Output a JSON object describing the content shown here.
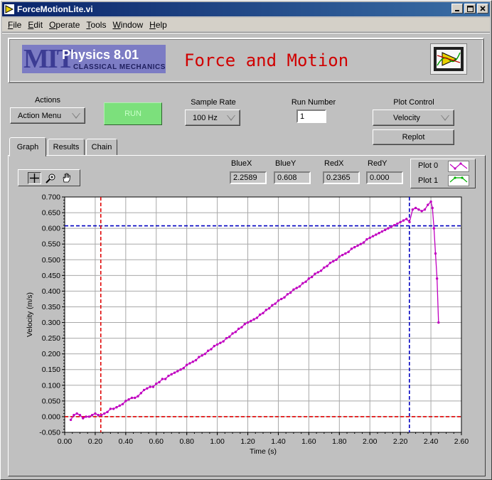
{
  "window": {
    "title": "ForceMotionLite.vi",
    "buttons": [
      "minimize",
      "maximize",
      "close"
    ]
  },
  "menu": [
    "File",
    "Edit",
    "Operate",
    "Tools",
    "Window",
    "Help"
  ],
  "banner": {
    "logo_mit": "MIT",
    "logo_course": "Physics 8.01",
    "logo_sub": "CLASSICAL MECHANICS",
    "title": "Force and Motion",
    "title_color": "#d00000"
  },
  "controls": {
    "actions_label": "Actions",
    "actions_value": "Action Menu",
    "run_label": "RUN",
    "run_color": "#7ce07c",
    "sample_rate_label": "Sample Rate",
    "sample_rate_value": "100 Hz",
    "run_number_label": "Run Number",
    "run_number_value": "1",
    "plot_control_label": "Plot Control",
    "plot_control_value": "Velocity",
    "replot_label": "Replot"
  },
  "tabs": [
    {
      "label": "Graph",
      "active": true
    },
    {
      "label": "Results",
      "active": false
    },
    {
      "label": "Chain",
      "active": false
    }
  ],
  "palette": [
    "crosshair-icon",
    "zoom-icon",
    "hand-icon"
  ],
  "cursors": {
    "blue_x_label": "BlueX",
    "blue_x": "2.2589",
    "blue_y_label": "BlueY",
    "blue_y": "0.608",
    "red_x_label": "RedX",
    "red_x": "0.2365",
    "red_y_label": "RedY",
    "red_y": "0.000"
  },
  "legend": [
    {
      "name": "Plot 0",
      "color": "#c000c0"
    },
    {
      "name": "Plot 1",
      "color": "#00b000"
    }
  ],
  "chart_data": {
    "type": "line",
    "xlabel": "Time (s)",
    "ylabel": "Velocity (m/s)",
    "xlim": [
      0.0,
      2.6
    ],
    "ylim": [
      -0.05,
      0.7
    ],
    "x_ticks": [
      "0.00",
      "0.20",
      "0.40",
      "0.60",
      "0.80",
      "1.00",
      "1.20",
      "1.40",
      "1.60",
      "1.80",
      "2.00",
      "2.20",
      "2.40",
      "2.60"
    ],
    "y_ticks": [
      "-0.050",
      "0.000",
      "0.050",
      "0.100",
      "0.150",
      "0.200",
      "0.250",
      "0.300",
      "0.350",
      "0.400",
      "0.450",
      "0.500",
      "0.550",
      "0.600",
      "0.650",
      "0.700"
    ],
    "grid": true,
    "series": [
      {
        "color": "#c000c0",
        "points": [
          [
            0.04,
            -0.01
          ],
          [
            0.06,
            0.005
          ],
          [
            0.08,
            0.01
          ],
          [
            0.1,
            0.005
          ],
          [
            0.12,
            -0.005
          ],
          [
            0.14,
            0.0
          ],
          [
            0.16,
            0.0
          ],
          [
            0.18,
            0.005
          ],
          [
            0.2,
            0.01
          ],
          [
            0.22,
            0.005
          ],
          [
            0.24,
            0.005
          ],
          [
            0.26,
            0.01
          ],
          [
            0.28,
            0.015
          ],
          [
            0.3,
            0.025
          ],
          [
            0.32,
            0.025
          ],
          [
            0.34,
            0.03
          ],
          [
            0.36,
            0.035
          ],
          [
            0.38,
            0.04
          ],
          [
            0.4,
            0.05
          ],
          [
            0.42,
            0.055
          ],
          [
            0.44,
            0.06
          ],
          [
            0.46,
            0.06
          ],
          [
            0.48,
            0.065
          ],
          [
            0.5,
            0.075
          ],
          [
            0.52,
            0.085
          ],
          [
            0.54,
            0.09
          ],
          [
            0.56,
            0.095
          ],
          [
            0.58,
            0.095
          ],
          [
            0.6,
            0.105
          ],
          [
            0.62,
            0.11
          ],
          [
            0.64,
            0.12
          ],
          [
            0.66,
            0.12
          ],
          [
            0.68,
            0.13
          ],
          [
            0.7,
            0.135
          ],
          [
            0.72,
            0.14
          ],
          [
            0.74,
            0.145
          ],
          [
            0.76,
            0.15
          ],
          [
            0.78,
            0.155
          ],
          [
            0.8,
            0.165
          ],
          [
            0.82,
            0.17
          ],
          [
            0.84,
            0.175
          ],
          [
            0.86,
            0.18
          ],
          [
            0.88,
            0.19
          ],
          [
            0.9,
            0.195
          ],
          [
            0.92,
            0.2
          ],
          [
            0.94,
            0.21
          ],
          [
            0.96,
            0.215
          ],
          [
            0.98,
            0.225
          ],
          [
            1.0,
            0.23
          ],
          [
            1.02,
            0.235
          ],
          [
            1.04,
            0.24
          ],
          [
            1.06,
            0.25
          ],
          [
            1.08,
            0.255
          ],
          [
            1.1,
            0.265
          ],
          [
            1.12,
            0.27
          ],
          [
            1.14,
            0.28
          ],
          [
            1.16,
            0.285
          ],
          [
            1.18,
            0.295
          ],
          [
            1.2,
            0.3
          ],
          [
            1.22,
            0.305
          ],
          [
            1.24,
            0.31
          ],
          [
            1.26,
            0.315
          ],
          [
            1.28,
            0.325
          ],
          [
            1.3,
            0.33
          ],
          [
            1.32,
            0.34
          ],
          [
            1.34,
            0.345
          ],
          [
            1.36,
            0.355
          ],
          [
            1.38,
            0.36
          ],
          [
            1.4,
            0.37
          ],
          [
            1.42,
            0.375
          ],
          [
            1.44,
            0.38
          ],
          [
            1.46,
            0.39
          ],
          [
            1.48,
            0.395
          ],
          [
            1.5,
            0.405
          ],
          [
            1.52,
            0.41
          ],
          [
            1.54,
            0.415
          ],
          [
            1.56,
            0.425
          ],
          [
            1.58,
            0.43
          ],
          [
            1.6,
            0.44
          ],
          [
            1.62,
            0.445
          ],
          [
            1.64,
            0.455
          ],
          [
            1.66,
            0.46
          ],
          [
            1.68,
            0.465
          ],
          [
            1.7,
            0.475
          ],
          [
            1.72,
            0.48
          ],
          [
            1.74,
            0.49
          ],
          [
            1.76,
            0.495
          ],
          [
            1.78,
            0.5
          ],
          [
            1.8,
            0.51
          ],
          [
            1.82,
            0.515
          ],
          [
            1.84,
            0.52
          ],
          [
            1.86,
            0.525
          ],
          [
            1.88,
            0.535
          ],
          [
            1.9,
            0.54
          ],
          [
            1.92,
            0.545
          ],
          [
            1.94,
            0.55
          ],
          [
            1.96,
            0.555
          ],
          [
            1.98,
            0.565
          ],
          [
            2.0,
            0.57
          ],
          [
            2.02,
            0.575
          ],
          [
            2.04,
            0.58
          ],
          [
            2.06,
            0.585
          ],
          [
            2.08,
            0.59
          ],
          [
            2.1,
            0.595
          ],
          [
            2.12,
            0.6
          ],
          [
            2.14,
            0.605
          ],
          [
            2.16,
            0.61
          ],
          [
            2.18,
            0.615
          ],
          [
            2.2,
            0.62
          ],
          [
            2.22,
            0.625
          ],
          [
            2.24,
            0.63
          ],
          [
            2.26,
            0.62
          ],
          [
            2.28,
            0.66
          ],
          [
            2.3,
            0.665
          ],
          [
            2.32,
            0.66
          ],
          [
            2.34,
            0.655
          ],
          [
            2.36,
            0.66
          ],
          [
            2.38,
            0.675
          ],
          [
            2.4,
            0.685
          ],
          [
            2.41,
            0.665
          ],
          [
            2.42,
            0.6
          ],
          [
            2.43,
            0.52
          ],
          [
            2.44,
            0.44
          ],
          [
            2.45,
            0.3
          ]
        ]
      }
    ],
    "cursors": [
      {
        "color": "#0000c0",
        "x": 2.2589,
        "y": 0.608
      },
      {
        "color": "#e00000",
        "x": 0.2365,
        "y": 0.0
      }
    ]
  }
}
